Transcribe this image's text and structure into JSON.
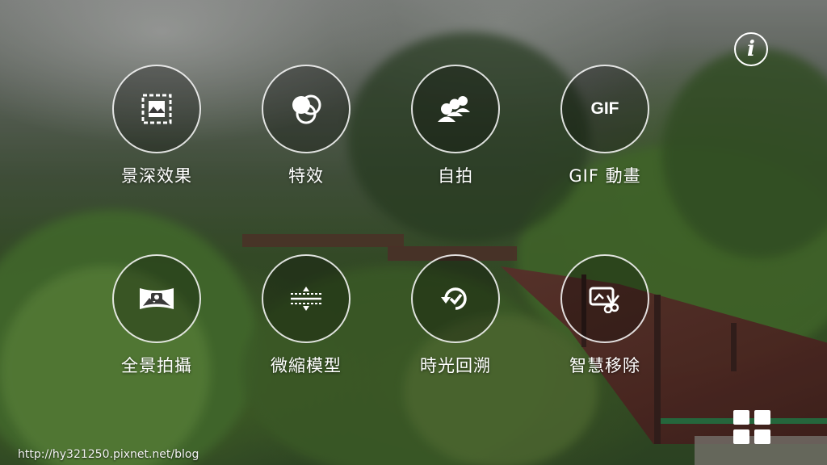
{
  "modes": [
    {
      "label": "景深效果",
      "icon": "depth-of-field-icon"
    },
    {
      "label": "特效",
      "icon": "effects-icon"
    },
    {
      "label": "自拍",
      "icon": "selfie-icon"
    },
    {
      "label": "GIF 動畫",
      "icon": "gif-icon",
      "icon_text": "GIF"
    },
    {
      "label": "全景拍攝",
      "icon": "panorama-icon"
    },
    {
      "label": "微縮模型",
      "icon": "miniature-icon"
    },
    {
      "label": "時光回溯",
      "icon": "time-rewind-icon"
    },
    {
      "label": "智慧移除",
      "icon": "smart-remove-icon"
    }
  ],
  "controls": {
    "info_glyph": "i",
    "info_icon": "info-icon",
    "grid_icon": "grid-menu-icon"
  },
  "watermark": "http://hy321250.pixnet.net/blog",
  "colors": {
    "icon": "#ffffff",
    "ring": "#ffffff",
    "label": "#ffffff"
  }
}
